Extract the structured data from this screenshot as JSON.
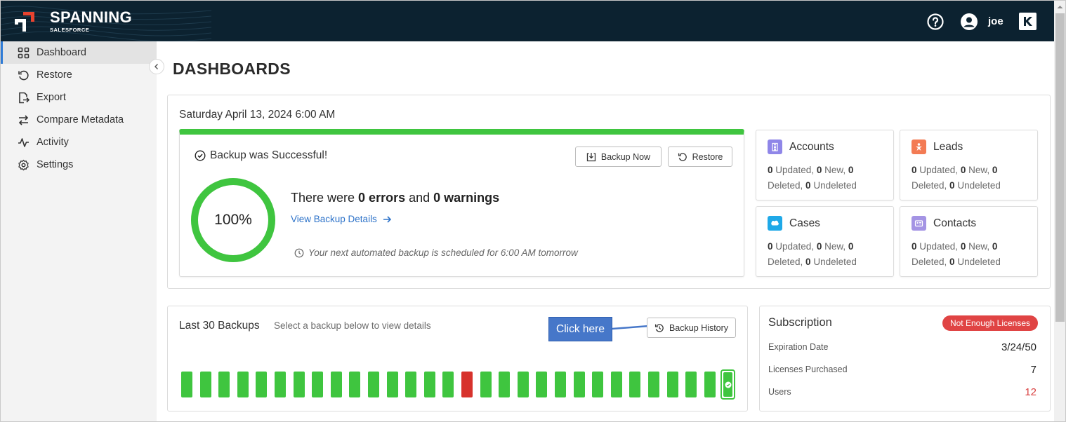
{
  "app": {
    "logo_text": "SPANNING",
    "logo_subtext": "SALESFORCE",
    "user_name": "joe"
  },
  "sidebar": {
    "items": [
      {
        "label": "Dashboard",
        "icon": "grid-icon",
        "active": true
      },
      {
        "label": "Restore",
        "icon": "restore-icon",
        "active": false
      },
      {
        "label": "Export",
        "icon": "export-icon",
        "active": false
      },
      {
        "label": "Compare Metadata",
        "icon": "compare-icon",
        "active": false
      },
      {
        "label": "Activity",
        "icon": "activity-icon",
        "active": false
      },
      {
        "label": "Settings",
        "icon": "gear-icon",
        "active": false
      }
    ]
  },
  "page": {
    "title": "DASHBOARDS",
    "date": "Saturday April 13, 2024 6:00 AM"
  },
  "backup": {
    "status": "Backup was Successful!",
    "percent": "100%",
    "progress": 1.0,
    "summary_prefix": "There were ",
    "errors": "0 errors",
    "summary_middle": " and ",
    "warnings": "0 warnings",
    "details_link": "View Backup Details",
    "schedule": "Your next automated backup is scheduled for 6:00 AM tomorrow",
    "backup_now_label": "Backup Now",
    "restore_label": "Restore"
  },
  "objects": [
    {
      "name": "Accounts",
      "icon": "accounts-icon",
      "color": "#8f86e8",
      "updated": "0",
      "new": "0",
      "deleted": "0",
      "undeleted": "0"
    },
    {
      "name": "Leads",
      "icon": "leads-icon",
      "color": "#f37b54",
      "updated": "0",
      "new": "0",
      "deleted": "0",
      "undeleted": "0"
    },
    {
      "name": "Cases",
      "icon": "cases-icon",
      "color": "#1fa9e8",
      "updated": "0",
      "new": "0",
      "deleted": "0",
      "undeleted": "0"
    },
    {
      "name": "Contacts",
      "icon": "contacts-icon",
      "color": "#a494e4",
      "updated": "0",
      "new": "0",
      "deleted": "0",
      "undeleted": "0"
    }
  ],
  "object_labels": {
    "updated": " Updated, ",
    "new": " New, ",
    "deleted": "Deleted, ",
    "undeleted": " Undeleted"
  },
  "last_backups": {
    "title": "Last 30 Backups",
    "subtitle": "Select a backup below to view details",
    "history_label": "Backup History",
    "callout": "Click here",
    "statuses": [
      "success",
      "success",
      "success",
      "success",
      "success",
      "success",
      "success",
      "success",
      "success",
      "success",
      "success",
      "success",
      "success",
      "success",
      "success",
      "failed",
      "success",
      "success",
      "success",
      "success",
      "success",
      "success",
      "success",
      "success",
      "success",
      "success",
      "success",
      "success",
      "success",
      "success"
    ],
    "selected_index": 29,
    "colors": {
      "success": "#3fc53f",
      "failed": "#d7322c"
    }
  },
  "subscription": {
    "title": "Subscription",
    "badge": "Not Enough Licenses",
    "rows": [
      {
        "label": "Expiration Date",
        "value": "3/24/50",
        "alert": false
      },
      {
        "label": "Licenses Purchased",
        "value": "7",
        "alert": false
      },
      {
        "label": "Users",
        "value": "12",
        "alert": true
      }
    ]
  }
}
